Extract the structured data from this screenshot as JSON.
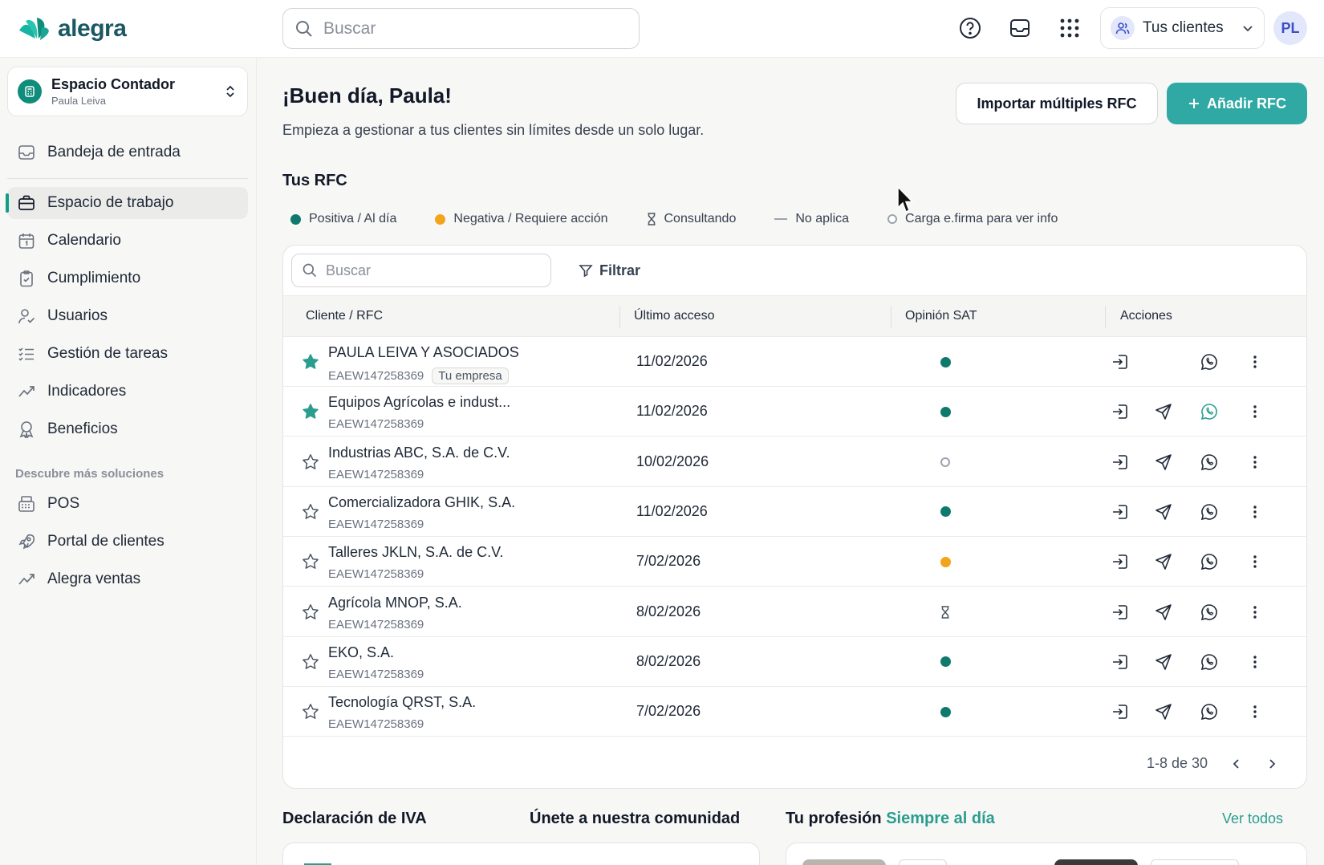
{
  "app": {
    "logo_text": "alegra",
    "brand_color": "#30a9a4"
  },
  "header": {
    "search_placeholder": "Buscar",
    "clients_label": "Tus clientes",
    "user_initials": "PL",
    "icons": [
      "help-icon",
      "inbox-icon",
      "apps-grid-icon",
      "users-icon",
      "chevron-down-icon"
    ]
  },
  "sidebar": {
    "workspace_title": "Espacio Contador",
    "workspace_user": "Paula Leiva",
    "items": [
      {
        "label": "Bandeja de entrada",
        "icon": "inbox-icon"
      },
      {
        "label": "Espacio de trabajo",
        "icon": "briefcase-icon",
        "active": true
      },
      {
        "label": "Calendario",
        "icon": "calendar-icon"
      },
      {
        "label": "Cumplimiento",
        "icon": "clipboard-check-icon"
      },
      {
        "label": "Usuarios",
        "icon": "user-check-icon"
      },
      {
        "label": "Gestión de tareas",
        "icon": "list-check-icon"
      },
      {
        "label": "Indicadores",
        "icon": "trend-icon"
      },
      {
        "label": "Beneficios",
        "icon": "award-icon"
      }
    ],
    "section_label": "Descubre más soluciones",
    "more_items": [
      {
        "label": "POS",
        "icon": "pos-icon"
      },
      {
        "label": "Portal de clientes",
        "icon": "rocket-icon"
      },
      {
        "label": "Alegra ventas",
        "icon": "trend-icon"
      }
    ]
  },
  "main": {
    "greeting": "¡Buen día, Paula!",
    "subtitle": "Empieza a gestionar a tus clientes sin límites desde un solo lugar.",
    "import_button": "Importar múltiples RFC",
    "add_button": "Añadir RFC",
    "section_title": "Tus RFC",
    "legend": [
      {
        "label": "Positiva / Al día",
        "kind": "green"
      },
      {
        "label": "Negativa / Requiere acción",
        "kind": "orange"
      },
      {
        "label": "Consultando",
        "kind": "hourglass"
      },
      {
        "label": "No aplica",
        "kind": "dash"
      },
      {
        "label": "Carga e.firma para ver info",
        "kind": "empty"
      }
    ],
    "table": {
      "search_placeholder": "Buscar",
      "filter_label": "Filtrar",
      "columns": [
        "Cliente / RFC",
        "Último acceso",
        "Opinión SAT",
        "Acciones"
      ],
      "rows": [
        {
          "name": "PAULA LEIVA Y ASOCIADOS",
          "rfc": "EAEW147258369",
          "badge": "Tu empresa",
          "date": "11/02/2026",
          "sat": "green",
          "starred": true,
          "send": false,
          "wa_active": false
        },
        {
          "name": "Equipos Agrícolas e indust...",
          "rfc": "EAEW147258369",
          "badge": "",
          "date": "11/02/2026",
          "sat": "green",
          "starred": true,
          "send": true,
          "wa_active": true
        },
        {
          "name": "Industrias ABC, S.A. de C.V.",
          "rfc": "EAEW147258369",
          "badge": "",
          "date": "10/02/2026",
          "sat": "empty",
          "starred": false,
          "send": true,
          "wa_active": false
        },
        {
          "name": "Comercializadora GHIK, S.A.",
          "rfc": "EAEW147258369",
          "badge": "",
          "date": "11/02/2026",
          "sat": "green",
          "starred": false,
          "send": true,
          "wa_active": false
        },
        {
          "name": "Talleres JKLN, S.A. de C.V.",
          "rfc": "EAEW147258369",
          "badge": "",
          "date": "7/02/2026",
          "sat": "orange",
          "starred": false,
          "send": true,
          "wa_active": false
        },
        {
          "name": "Agrícola MNOP, S.A.",
          "rfc": "EAEW147258369",
          "badge": "",
          "date": "8/02/2026",
          "sat": "hourglass",
          "starred": false,
          "send": true,
          "wa_active": false
        },
        {
          "name": "EKO, S.A.",
          "rfc": "EAEW147258369",
          "badge": "",
          "date": "8/02/2026",
          "sat": "green",
          "starred": false,
          "send": true,
          "wa_active": false
        },
        {
          "name": "Tecnología QRST, S.A.",
          "rfc": "EAEW147258369",
          "badge": "",
          "date": "7/02/2026",
          "sat": "green",
          "starred": false,
          "send": true,
          "wa_active": false
        }
      ],
      "pagination": "1-8 de 30"
    },
    "bottom": {
      "iva_title": "Declaración de IVA",
      "community_title": "Únete a nuestra comunidad",
      "profession_title": "Tu profesión",
      "profession_accent": "Siempre al día",
      "see_all": "Ver todos"
    }
  }
}
